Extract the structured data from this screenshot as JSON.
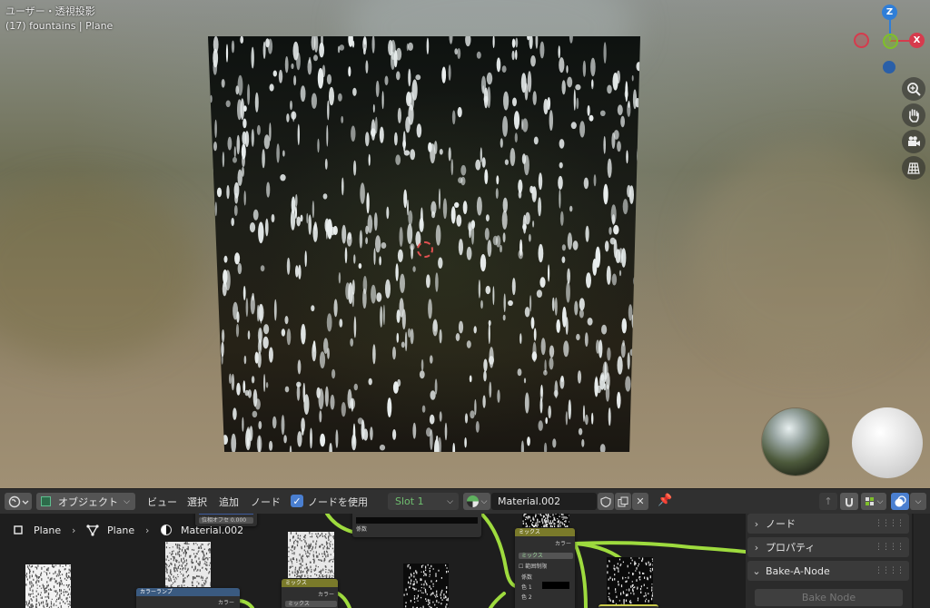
{
  "viewport": {
    "view_name": "ユーザー・透視投影",
    "object_info": "(17) fountains | Plane",
    "gizmo": {
      "z": "Z",
      "x": "X"
    },
    "nav_icons": [
      "zoom-icon",
      "hand-pan-icon",
      "camera-icon",
      "grid-icon"
    ]
  },
  "header": {
    "editor_type_icon": "node-editor-icon",
    "mode_label": "オブジェクト",
    "menus": [
      "ビュー",
      "選択",
      "追加",
      "ノード"
    ],
    "use_nodes_label": "ノードを使用",
    "use_nodes_checked": true,
    "slot_label": "Slot 1",
    "material_name": "Material.002"
  },
  "breadcrumb": {
    "items": [
      "Plane",
      "Plane",
      "Material.002"
    ]
  },
  "nodes": {
    "color_ramp_title": "カラーランプ",
    "color_ramp_out": "カラー",
    "offset_label": "位相オフセ 0.000",
    "mix_title": "ミックス",
    "mix_color": "カラー",
    "mix_sub": "ミックス",
    "factor_label": "係数",
    "mix2_title": "ミックス",
    "mix2_color": "カラー",
    "mix2_dropdown": "ミックス",
    "mix2_clamp": "範囲制限",
    "mix2_fac": "係数",
    "mix2_color1": "色 1",
    "mix2_color2": "色 2"
  },
  "sidebar": {
    "panels": [
      "ノード",
      "プロパティ",
      "Bake-A-Node"
    ],
    "bake_button": "Bake Node"
  },
  "colors": {
    "wire": "#9edb3e",
    "gizmo_x": "#d63b4d",
    "gizmo_y": "#7fbf2a",
    "gizmo_z": "#2f7ed8",
    "accent": "#4a7fd0"
  }
}
